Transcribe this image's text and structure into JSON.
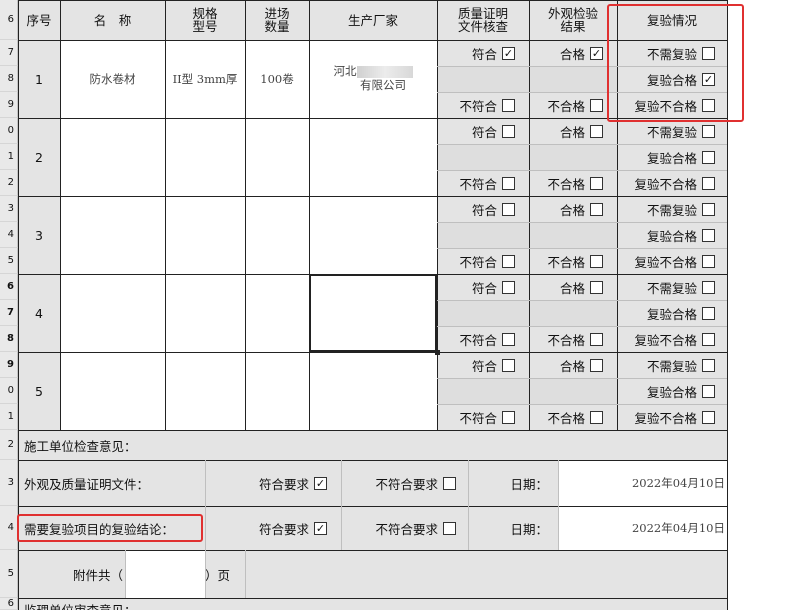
{
  "row_numbers": [
    "6",
    "7",
    "8",
    "9",
    "0",
    "1",
    "2",
    "3",
    "4",
    "5",
    "6",
    "7",
    "8",
    "9",
    "0",
    "1",
    "2",
    "3",
    "4",
    "5",
    "6"
  ],
  "header": {
    "seq": "序号",
    "name": "名　称",
    "spec_l1": "规格",
    "spec_l2": "型号",
    "qty_l1": "进场",
    "qty_l2": "数量",
    "maker": "生产厂家",
    "cert_l1": "质量证明",
    "cert_l2": "文件核查",
    "look_l1": "外观检验",
    "look_l2": "结果",
    "retest": "复验情况"
  },
  "options": {
    "conform": "符合",
    "nonconform": "不符合",
    "pass": "合格",
    "fail": "不合格",
    "no_retest": "不需复验",
    "retest_pass": "复验合格",
    "retest_fail": "复验不合格"
  },
  "rows": [
    {
      "seq": "1",
      "name": "防水卷材",
      "spec": "II型 3mm厚",
      "qty": "100卷",
      "maker_l1": "河北",
      "maker_l2": "有限公司",
      "conform": true,
      "nonconform": false,
      "pass": true,
      "fail": false,
      "no_retest": false,
      "retest_pass": true,
      "retest_fail": false
    },
    {
      "seq": "2",
      "name": "",
      "spec": "",
      "qty": "",
      "maker_l1": "",
      "maker_l2": "",
      "conform": false,
      "nonconform": false,
      "pass": false,
      "fail": false,
      "no_retest": false,
      "retest_pass": false,
      "retest_fail": false
    },
    {
      "seq": "3",
      "name": "",
      "spec": "",
      "qty": "",
      "maker_l1": "",
      "maker_l2": "",
      "conform": false,
      "nonconform": false,
      "pass": false,
      "fail": false,
      "no_retest": false,
      "retest_pass": false,
      "retest_fail": false
    },
    {
      "seq": "4",
      "name": "",
      "spec": "",
      "qty": "",
      "maker_l1": "",
      "maker_l2": "",
      "conform": false,
      "nonconform": false,
      "pass": false,
      "fail": false,
      "no_retest": false,
      "retest_pass": false,
      "retest_fail": false
    },
    {
      "seq": "5",
      "name": "",
      "spec": "",
      "qty": "",
      "maker_l1": "",
      "maker_l2": "",
      "conform": false,
      "nonconform": false,
      "pass": false,
      "fail": false,
      "no_retest": false,
      "retest_pass": false,
      "retest_fail": false
    }
  ],
  "check_mark": "✓",
  "footer": {
    "contractor_opinion": "施工单位检查意见：",
    "appearance_label": "外观及质量证明文件：",
    "retest_label": "需要复验项目的复验结论：",
    "meets": "符合要求",
    "not_meets": "不符合要求",
    "date_label": "日期：",
    "date1": "2022年04月10日",
    "date2": "2022年04月10日",
    "appearance_meets": true,
    "appearance_not_meets": false,
    "retest_meets": true,
    "retest_not_meets": false,
    "attach_prefix": "附件共（",
    "attach_suffix": "）页",
    "attach_value": "",
    "supervisor_opinion": "监理单位审查意见："
  }
}
